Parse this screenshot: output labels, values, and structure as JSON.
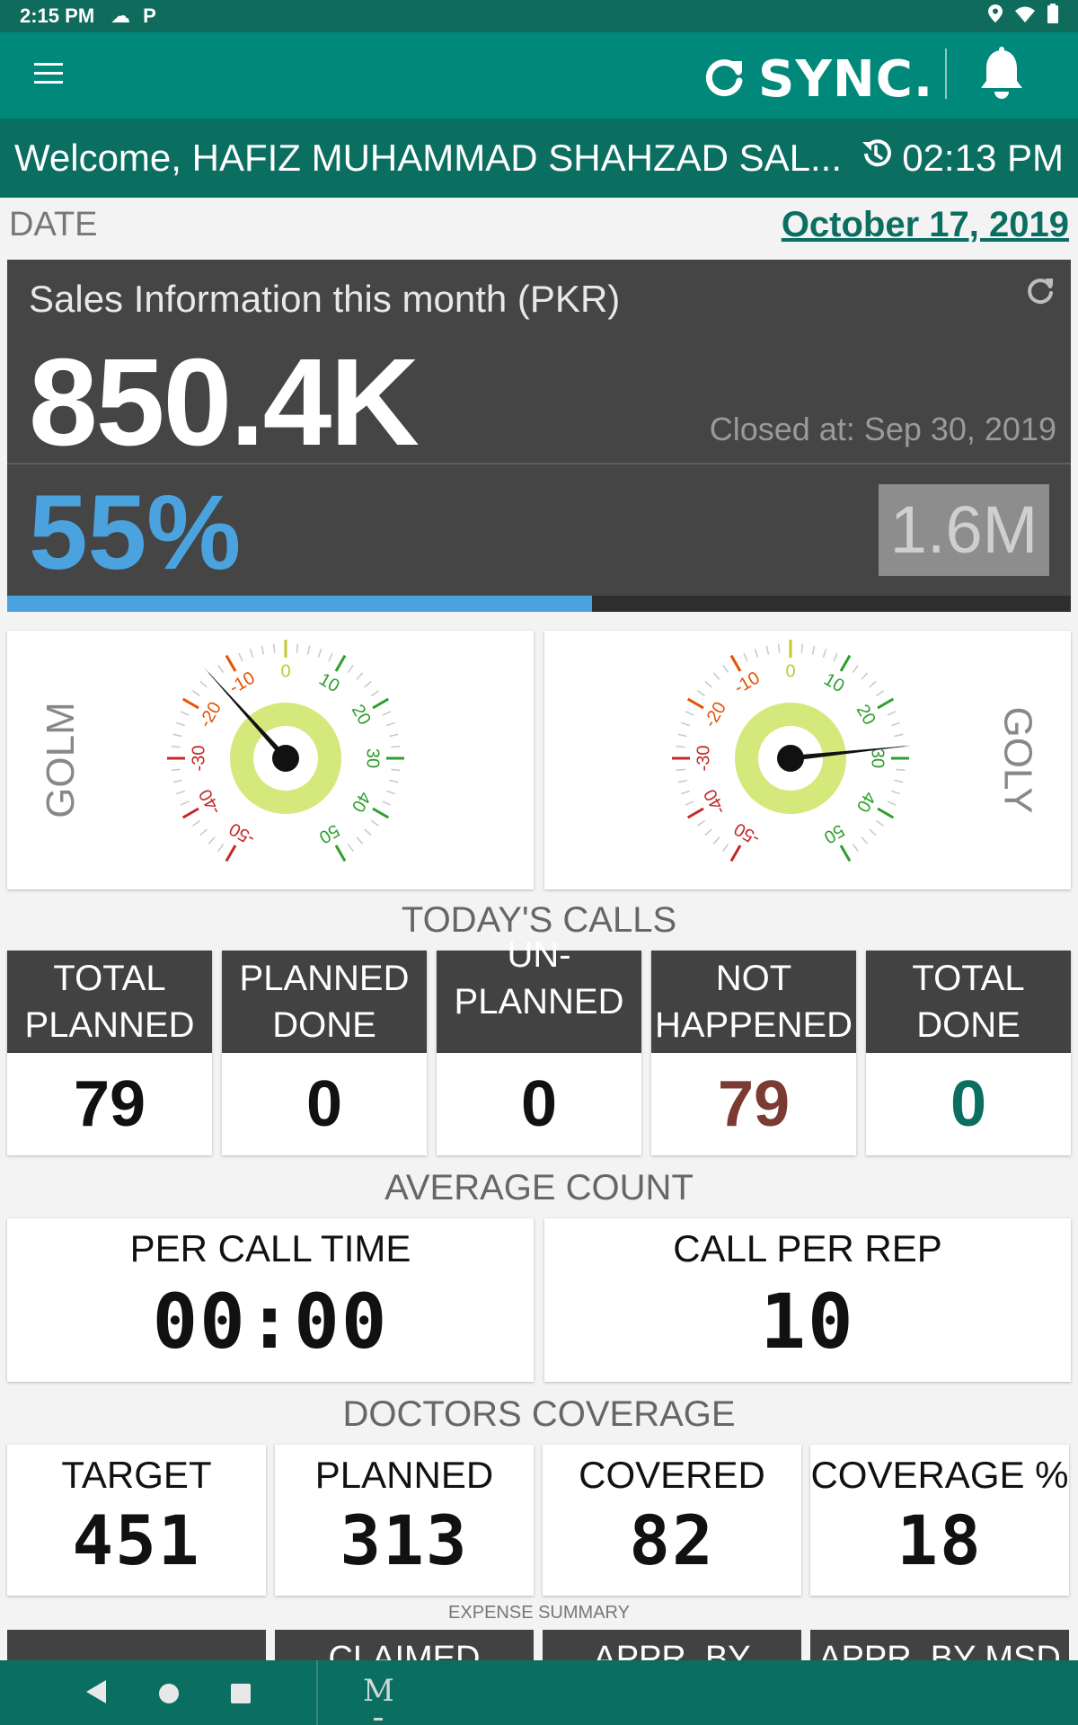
{
  "status_bar": {
    "time": "2:15 PM",
    "icons_left": [
      "weather-icon",
      "parking-icon"
    ],
    "icons_right": [
      "location-icon",
      "wifi-icon",
      "battery-icon"
    ]
  },
  "app_bar": {
    "sync_label": "SYNC.",
    "menu_icon": "hamburger-icon",
    "notification_icon": "bell-icon"
  },
  "welcome": {
    "text": "Welcome, HAFIZ MUHAMMAD SHAHZAD SAL...",
    "time": "02:13 PM"
  },
  "date": {
    "label": "DATE",
    "value": "October 17, 2019"
  },
  "sales": {
    "title": "Sales Information this month (PKR)",
    "value": "850.4K",
    "closed": "Closed at: Sep 30, 2019",
    "percent_label": "55%",
    "percent": 55,
    "target": "1.6M"
  },
  "gauges": [
    {
      "label": "GOLM",
      "value": -14,
      "min": -50,
      "max": 50
    },
    {
      "label": "GOLY",
      "value": 28,
      "min": -50,
      "max": 50
    }
  ],
  "gauge_ticks": [
    "-50",
    "-40",
    "-30",
    "-20",
    "-10",
    "0",
    "10",
    "20",
    "30",
    "40",
    "50"
  ],
  "todays_calls": {
    "title": "TODAY'S CALLS",
    "items": [
      {
        "label": "TOTAL PLANNED",
        "value": "79",
        "color": "#111111"
      },
      {
        "label": "PLANNED DONE",
        "value": "0",
        "color": "#111111"
      },
      {
        "label": "UN- PLANNED ...",
        "value": "0",
        "color": "#111111"
      },
      {
        "label": "NOT HAPPENED",
        "value": "79",
        "color": "#7b3a32"
      },
      {
        "label": "TOTAL DONE",
        "value": "0",
        "color": "#0a6e61"
      }
    ]
  },
  "average_count": {
    "title": "AVERAGE COUNT",
    "per_call_time_label": "PER CALL TIME",
    "per_call_time": "00:00",
    "call_per_rep_label": "CALL PER REP",
    "call_per_rep": "10"
  },
  "doctors_coverage": {
    "title": "DOCTORS COVERAGE",
    "items": [
      {
        "label": "TARGET",
        "value": "451"
      },
      {
        "label": "PLANNED",
        "value": "313"
      },
      {
        "label": "COVERED",
        "value": "82"
      },
      {
        "label": "COVERAGE %",
        "value": "18"
      }
    ]
  },
  "expense_summary": {
    "title": "EXPENSE SUMMARY",
    "items": [
      "",
      "CLAIMED",
      "APPR. BY",
      "APPR. BY MSD"
    ]
  },
  "nav_bar": {
    "app_label": "M",
    "colors": {
      "primary": "#00897b",
      "primary_dark": "#0a6e61",
      "accent": "#4aa3df"
    }
  }
}
